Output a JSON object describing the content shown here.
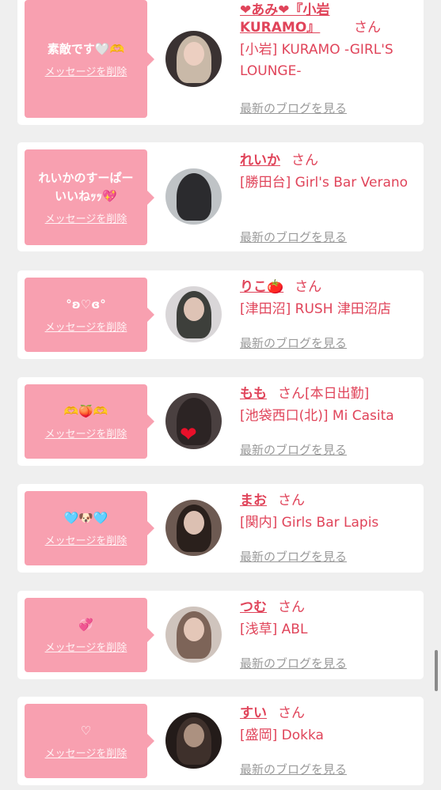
{
  "common": {
    "delete_label": "メッセージを削除",
    "san": "さん",
    "blog_label": "最新のブログを見る"
  },
  "colors": {
    "bubble": "#f8a0b0",
    "accent": "#e0445a",
    "muted": "#9a9a9a",
    "background": "#efefef"
  },
  "cards": [
    {
      "message": "素敵です🤍🫶",
      "name": "❤あみ❤『小岩KURAMO』",
      "extra": "",
      "shop": "[小岩] KURAMO -GIRL'S LOUNGE-",
      "avatar_icon": "girl-portrait-icon"
    },
    {
      "message": "れいかのすーぱー\nいいねｯｯ💖",
      "name": "れいか",
      "extra": "",
      "shop": "[勝田台] Girl's Bar Verano",
      "avatar_icon": "girl-portrait-icon"
    },
    {
      "message": "°ʚ♡ɞ°",
      "name": "りこ🍅",
      "extra": "",
      "shop": "[津田沼] RUSH 津田沼店",
      "avatar_icon": "girl-portrait-icon"
    },
    {
      "message": "🫶🍑🫶",
      "name": "もも",
      "extra": "[本日出勤]",
      "shop": "[池袋西口(北)] Mi Casita",
      "avatar_icon": "girl-portrait-heart-icon"
    },
    {
      "message": "🩵🐶🩵",
      "name": "まお",
      "extra": "",
      "shop": "[関内] Girls Bar Lapis",
      "avatar_icon": "girl-portrait-icon"
    },
    {
      "message": "💞",
      "name": "つむ",
      "extra": "",
      "shop": "[浅草] ABL",
      "avatar_icon": "girl-portrait-icon"
    },
    {
      "message": "♡",
      "name": "すい",
      "extra": "",
      "shop": "[盛岡] Dokka",
      "avatar_icon": "girl-portrait-icon"
    }
  ]
}
